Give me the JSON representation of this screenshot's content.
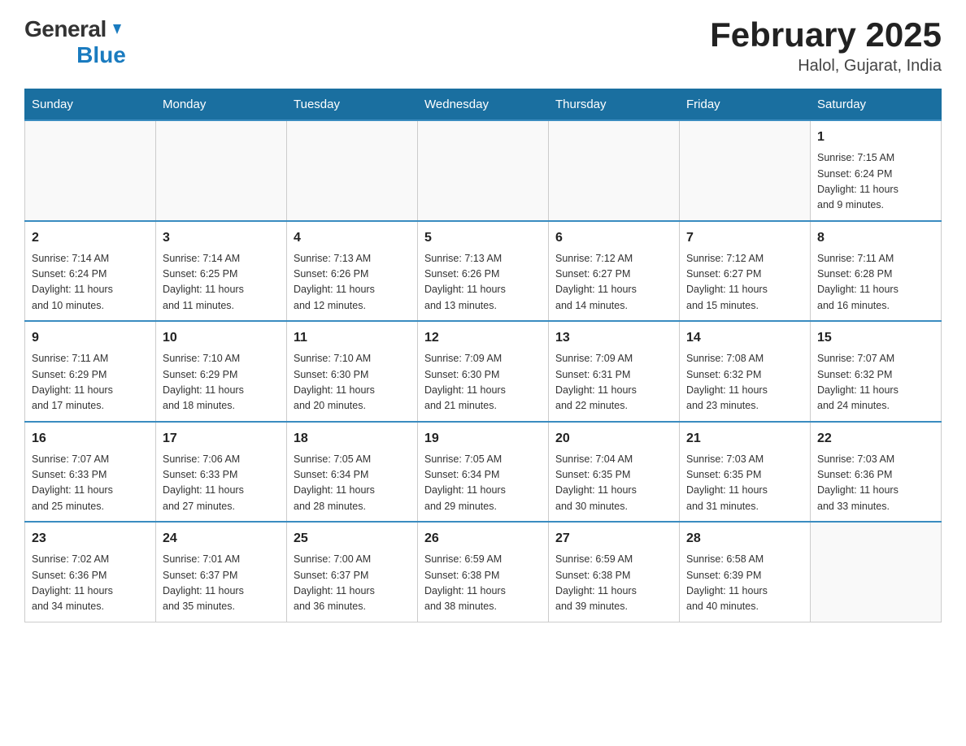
{
  "header": {
    "logo_general": "General",
    "logo_blue": "Blue",
    "month_title": "February 2025",
    "location": "Halol, Gujarat, India"
  },
  "days_of_week": [
    "Sunday",
    "Monday",
    "Tuesday",
    "Wednesday",
    "Thursday",
    "Friday",
    "Saturday"
  ],
  "weeks": [
    [
      {
        "day": "",
        "info": ""
      },
      {
        "day": "",
        "info": ""
      },
      {
        "day": "",
        "info": ""
      },
      {
        "day": "",
        "info": ""
      },
      {
        "day": "",
        "info": ""
      },
      {
        "day": "",
        "info": ""
      },
      {
        "day": "1",
        "info": "Sunrise: 7:15 AM\nSunset: 6:24 PM\nDaylight: 11 hours\nand 9 minutes."
      }
    ],
    [
      {
        "day": "2",
        "info": "Sunrise: 7:14 AM\nSunset: 6:24 PM\nDaylight: 11 hours\nand 10 minutes."
      },
      {
        "day": "3",
        "info": "Sunrise: 7:14 AM\nSunset: 6:25 PM\nDaylight: 11 hours\nand 11 minutes."
      },
      {
        "day": "4",
        "info": "Sunrise: 7:13 AM\nSunset: 6:26 PM\nDaylight: 11 hours\nand 12 minutes."
      },
      {
        "day": "5",
        "info": "Sunrise: 7:13 AM\nSunset: 6:26 PM\nDaylight: 11 hours\nand 13 minutes."
      },
      {
        "day": "6",
        "info": "Sunrise: 7:12 AM\nSunset: 6:27 PM\nDaylight: 11 hours\nand 14 minutes."
      },
      {
        "day": "7",
        "info": "Sunrise: 7:12 AM\nSunset: 6:27 PM\nDaylight: 11 hours\nand 15 minutes."
      },
      {
        "day": "8",
        "info": "Sunrise: 7:11 AM\nSunset: 6:28 PM\nDaylight: 11 hours\nand 16 minutes."
      }
    ],
    [
      {
        "day": "9",
        "info": "Sunrise: 7:11 AM\nSunset: 6:29 PM\nDaylight: 11 hours\nand 17 minutes."
      },
      {
        "day": "10",
        "info": "Sunrise: 7:10 AM\nSunset: 6:29 PM\nDaylight: 11 hours\nand 18 minutes."
      },
      {
        "day": "11",
        "info": "Sunrise: 7:10 AM\nSunset: 6:30 PM\nDaylight: 11 hours\nand 20 minutes."
      },
      {
        "day": "12",
        "info": "Sunrise: 7:09 AM\nSunset: 6:30 PM\nDaylight: 11 hours\nand 21 minutes."
      },
      {
        "day": "13",
        "info": "Sunrise: 7:09 AM\nSunset: 6:31 PM\nDaylight: 11 hours\nand 22 minutes."
      },
      {
        "day": "14",
        "info": "Sunrise: 7:08 AM\nSunset: 6:32 PM\nDaylight: 11 hours\nand 23 minutes."
      },
      {
        "day": "15",
        "info": "Sunrise: 7:07 AM\nSunset: 6:32 PM\nDaylight: 11 hours\nand 24 minutes."
      }
    ],
    [
      {
        "day": "16",
        "info": "Sunrise: 7:07 AM\nSunset: 6:33 PM\nDaylight: 11 hours\nand 25 minutes."
      },
      {
        "day": "17",
        "info": "Sunrise: 7:06 AM\nSunset: 6:33 PM\nDaylight: 11 hours\nand 27 minutes."
      },
      {
        "day": "18",
        "info": "Sunrise: 7:05 AM\nSunset: 6:34 PM\nDaylight: 11 hours\nand 28 minutes."
      },
      {
        "day": "19",
        "info": "Sunrise: 7:05 AM\nSunset: 6:34 PM\nDaylight: 11 hours\nand 29 minutes."
      },
      {
        "day": "20",
        "info": "Sunrise: 7:04 AM\nSunset: 6:35 PM\nDaylight: 11 hours\nand 30 minutes."
      },
      {
        "day": "21",
        "info": "Sunrise: 7:03 AM\nSunset: 6:35 PM\nDaylight: 11 hours\nand 31 minutes."
      },
      {
        "day": "22",
        "info": "Sunrise: 7:03 AM\nSunset: 6:36 PM\nDaylight: 11 hours\nand 33 minutes."
      }
    ],
    [
      {
        "day": "23",
        "info": "Sunrise: 7:02 AM\nSunset: 6:36 PM\nDaylight: 11 hours\nand 34 minutes."
      },
      {
        "day": "24",
        "info": "Sunrise: 7:01 AM\nSunset: 6:37 PM\nDaylight: 11 hours\nand 35 minutes."
      },
      {
        "day": "25",
        "info": "Sunrise: 7:00 AM\nSunset: 6:37 PM\nDaylight: 11 hours\nand 36 minutes."
      },
      {
        "day": "26",
        "info": "Sunrise: 6:59 AM\nSunset: 6:38 PM\nDaylight: 11 hours\nand 38 minutes."
      },
      {
        "day": "27",
        "info": "Sunrise: 6:59 AM\nSunset: 6:38 PM\nDaylight: 11 hours\nand 39 minutes."
      },
      {
        "day": "28",
        "info": "Sunrise: 6:58 AM\nSunset: 6:39 PM\nDaylight: 11 hours\nand 40 minutes."
      },
      {
        "day": "",
        "info": ""
      }
    ]
  ]
}
